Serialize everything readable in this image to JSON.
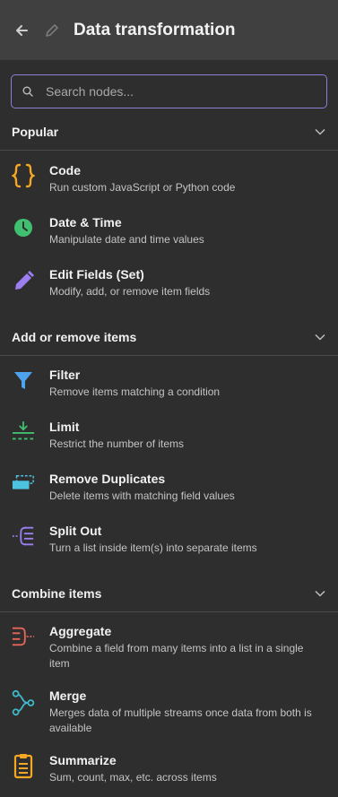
{
  "header": {
    "title": "Data transformation",
    "back_icon": "arrow-left-icon",
    "edit_icon": "pencil-icon"
  },
  "search": {
    "placeholder": "Search nodes..."
  },
  "sections": [
    {
      "title": "Popular",
      "items": [
        {
          "name": "Code",
          "desc": "Run custom JavaScript or Python code",
          "icon": "code-braces-icon"
        },
        {
          "name": "Date & Time",
          "desc": "Manipulate date and time values",
          "icon": "clock-icon"
        },
        {
          "name": "Edit Fields (Set)",
          "desc": "Modify, add, or remove item fields",
          "icon": "pen-icon"
        }
      ]
    },
    {
      "title": "Add or remove items",
      "items": [
        {
          "name": "Filter",
          "desc": "Remove items matching a condition",
          "icon": "filter-icon"
        },
        {
          "name": "Limit",
          "desc": "Restrict the number of items",
          "icon": "limit-icon"
        },
        {
          "name": "Remove Duplicates",
          "desc": "Delete items with matching field values",
          "icon": "remove-duplicates-icon"
        },
        {
          "name": "Split Out",
          "desc": "Turn a list inside item(s) into separate items",
          "icon": "split-out-icon"
        }
      ]
    },
    {
      "title": "Combine items",
      "items": [
        {
          "name": "Aggregate",
          "desc": "Combine a field from many items into a list in a single item",
          "icon": "aggregate-icon"
        },
        {
          "name": "Merge",
          "desc": "Merges data of multiple streams once data from both is available",
          "icon": "merge-icon"
        },
        {
          "name": "Summarize",
          "desc": "Sum, count, max, etc. across items",
          "icon": "clipboard-icon"
        }
      ]
    }
  ],
  "colors": {
    "accent": "#8a7fd9",
    "orange": "#f5a623",
    "green": "#3fbf6f",
    "purple": "#9b7ef0",
    "blue": "#4ea3ef",
    "red": "#e8665a",
    "teal": "#3fb8c9"
  }
}
